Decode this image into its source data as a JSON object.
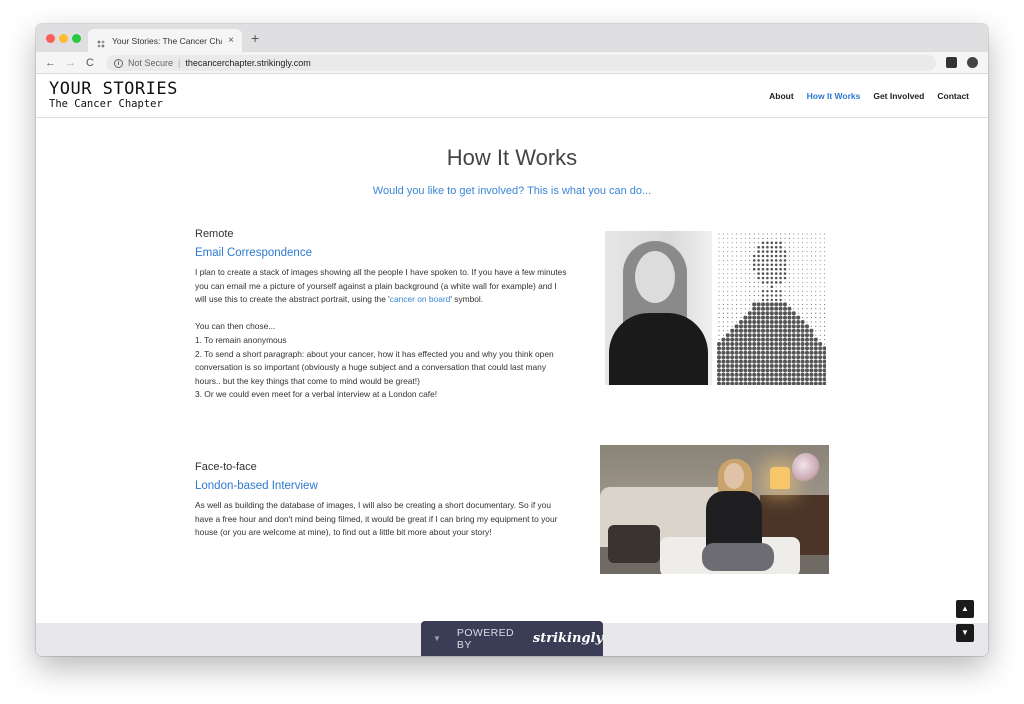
{
  "browser": {
    "tab_title": "Your Stories: The Cancer Chap",
    "tab_close": "×",
    "new_tab": "+",
    "nav_back": "←",
    "nav_forward": "→",
    "nav_reload": "C",
    "security_label": "Not Secure",
    "url": "thecancerchapter.strikingly.com"
  },
  "site": {
    "brand_title": "YOUR STORIES",
    "brand_subtitle": "The Cancer Chapter",
    "nav": {
      "about": "About",
      "how_it_works": "How It Works",
      "get_involved": "Get Involved",
      "contact": "Contact"
    },
    "active_nav": "How It Works"
  },
  "main": {
    "title": "How It Works",
    "subtitle": "Would you like to get involved? This is what you can do...",
    "remote": {
      "label": "Remote",
      "heading": "Email Correspondence",
      "intro_before_link": "I plan to create a stack of images showing all the people I have spoken to. If you have a few minutes you can email me a picture of yourself against a plain background (a white wall for example) and I will use this to create the abstract portrait, using the '",
      "intro_link": "cancer on board",
      "intro_after_link": "' symbol.",
      "choices_intro": "You can then chose...",
      "choice_1": "1. To remain anonymous",
      "choice_2": "2. To send a short paragraph: about your cancer, how it has effected you and why you think open conversation is so important (obviously a huge subject and a conversation that could last many hours.. but the key things that come to mind would be great!)",
      "choice_3": "3. Or we could even meet for a verbal interview at a London cafe!"
    },
    "face_to_face": {
      "label": "Face-to-face",
      "heading": "London-based Interview",
      "body": "As well as building the database of images, I will also be creating a short documentary. So if you have a free hour and don't mind being filmed, it would be great if I can bring my equipment to your house (or you are welcome at mine), to find out a little bit more about your story!"
    }
  },
  "footer": {
    "powered_arrow": "▼",
    "powered_by": "POWERED BY",
    "brand": "strikingly",
    "scroll_up": "▲",
    "scroll_down": "▼"
  },
  "colors": {
    "accent": "#2d7ad0",
    "footer_badge": "#3a3d55",
    "text": "#333333"
  }
}
